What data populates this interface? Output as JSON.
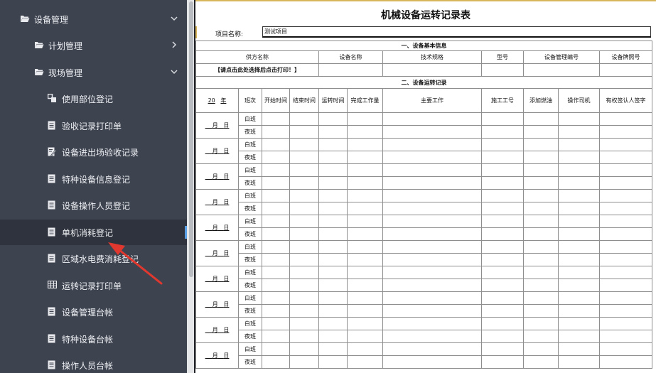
{
  "sidebar": {
    "items": [
      {
        "label": "设备管理",
        "icon": "folder-open-icon",
        "chevron": "down"
      },
      {
        "label": "计划管理",
        "icon": "folder-open-icon",
        "chevron": "right"
      },
      {
        "label": "现场管理",
        "icon": "folder-open-icon",
        "chevron": "down"
      },
      {
        "label": "使用部位登记",
        "icon": "link-icon"
      },
      {
        "label": "验收记录打印单",
        "icon": "document-icon"
      },
      {
        "label": "设备进出场验收记录",
        "icon": "edit-document-icon"
      },
      {
        "label": "特种设备信息登记",
        "icon": "document-icon"
      },
      {
        "label": "设备操作人员登记",
        "icon": "document-icon"
      },
      {
        "label": "单机消耗登记",
        "icon": "document-icon",
        "active": true
      },
      {
        "label": "区域水电费消耗登记",
        "icon": "document-icon"
      },
      {
        "label": "运转记录打印单",
        "icon": "table-icon"
      },
      {
        "label": "设备管理台帐",
        "icon": "document-icon"
      },
      {
        "label": "特种设备台帐",
        "icon": "document-icon"
      },
      {
        "label": "操作人员台帐",
        "icon": "document-icon"
      }
    ]
  },
  "colors": {
    "sidebar_bg": "#3e4350",
    "active_bg": "#2f333d",
    "arrow": "#e0382e"
  },
  "form": {
    "title": "机械设备运转记录表",
    "project_label": "项目名称:",
    "project_value": "测试项目",
    "section1": "一、设备基本信息",
    "info_headers": [
      "供方名称",
      "设备名称",
      "技术规格",
      "型号",
      "设备管理编号",
      "设备牌照号"
    ],
    "select_hint": "【请点击此处选择后点击打印！】",
    "section2": "二、设备运转记录",
    "log_headers": {
      "year_prefix": "20",
      "year_suffix": "年",
      "shift": "班次",
      "start_time": "开始时间",
      "end_time": "结束时间",
      "run_time": "运转时间",
      "work_done": "完成工作量",
      "main_work": "主要工作",
      "work_no": "施工工号",
      "fuel": "添加燃油",
      "operator": "操作司机",
      "signer": "有权签认人签字"
    },
    "date_month": "月",
    "date_day": "日",
    "day_shift": "白班",
    "night_shift": "夜班",
    "day_count": 10
  }
}
